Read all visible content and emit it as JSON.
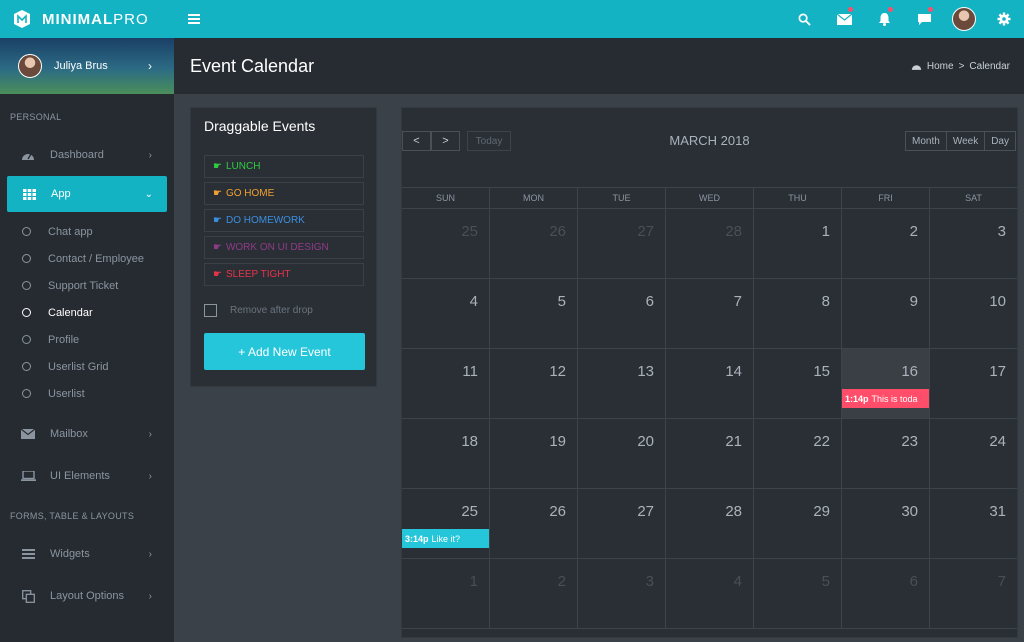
{
  "brand": {
    "name_bold": "MINIMAL",
    "name_light": "PRO"
  },
  "sidebar": {
    "user": {
      "name": "Juliya Brus"
    },
    "sections": [
      "PERSONAL",
      "FORMS, TABLE & LAYOUTS"
    ],
    "items": {
      "dashboard": "Dashboard",
      "app": "App",
      "mailbox": "Mailbox",
      "ui_elements": "UI Elements",
      "widgets": "Widgets",
      "layout_options": "Layout Options"
    },
    "app_sub": [
      "Chat app",
      "Contact / Employee",
      "Support Ticket",
      "Calendar",
      "Profile",
      "Userlist Grid",
      "Userlist"
    ]
  },
  "header": {
    "title": "Event Calendar",
    "breadcrumb_home": "Home",
    "breadcrumb_sep": ">",
    "breadcrumb_current": "Calendar"
  },
  "events_panel": {
    "title": "Draggable Events",
    "events": [
      {
        "label": "LUNCH",
        "color": "#2ecc40"
      },
      {
        "label": "GO HOME",
        "color": "#f0a030"
      },
      {
        "label": "DO HOMEWORK",
        "color": "#3b8fe0"
      },
      {
        "label": "WORK ON UI DESIGN",
        "color": "#8e3b88"
      },
      {
        "label": "SLEEP TIGHT",
        "color": "#e8334a"
      }
    ],
    "remove_label": "Remove after drop",
    "add_button": "+ Add New Event"
  },
  "calendar": {
    "title": "MARCH 2018",
    "today_label": "Today",
    "views": [
      "Month",
      "Week",
      "Day"
    ],
    "dow": [
      "SUN",
      "MON",
      "TUE",
      "WED",
      "THU",
      "FRI",
      "SAT"
    ],
    "weeks": [
      [
        25,
        26,
        27,
        28,
        1,
        2,
        3
      ],
      [
        4,
        5,
        6,
        7,
        8,
        9,
        10
      ],
      [
        11,
        12,
        13,
        14,
        15,
        16,
        17
      ],
      [
        18,
        19,
        20,
        21,
        22,
        23,
        24
      ],
      [
        25,
        26,
        27,
        28,
        29,
        30,
        31
      ],
      [
        1,
        2,
        3,
        4,
        5,
        6,
        7
      ]
    ],
    "calendar_events": [
      {
        "time": "1:14p",
        "title": "This is toda",
        "color": "#ff4d6a"
      },
      {
        "time": "3:14p",
        "title": "Like it?",
        "color": "#26c6da"
      }
    ]
  },
  "colors": {
    "accent": "#14b3c4",
    "button": "#26c6da"
  }
}
